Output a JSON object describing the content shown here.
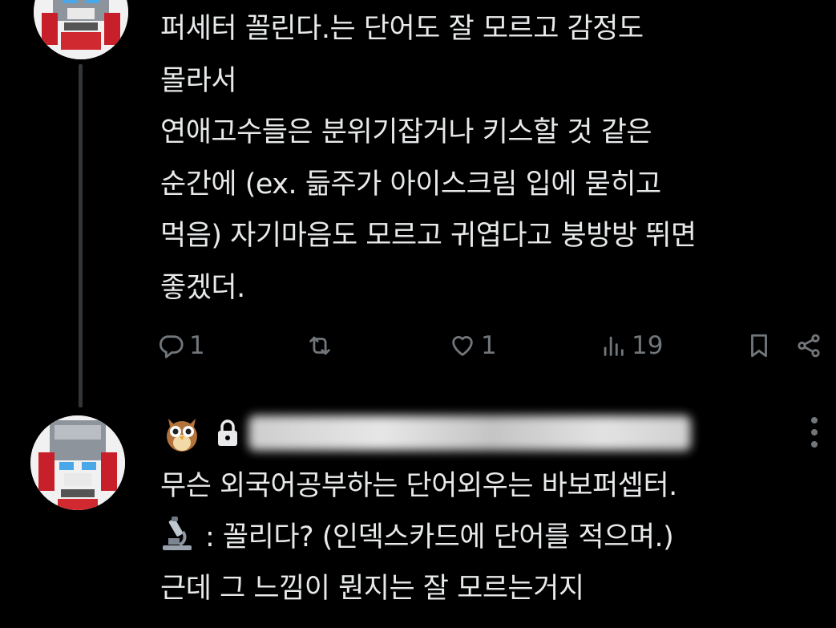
{
  "thread": {
    "tweet1": {
      "avatar": "robot-avatar",
      "lines": [
        "퍼세터 꼴린다.는 단어도 잘 모르고 감정도",
        "몰라서",
        "연애고수들은 분위기잡거나 키스할 것 같은",
        "순간에 (ex. 듦주가 아이스크림 입에 묻히고",
        "먹음) 자기마음도 모르고 귀엽다고 붕방방 뛰면",
        "좋겠더."
      ],
      "actions": {
        "reply_icon": "reply-icon",
        "reply_count": "1",
        "retweet_icon": "retweet-icon",
        "retweet_count": "",
        "like_icon": "heart-icon",
        "like_count": "1",
        "views_icon": "views-icon",
        "views_count": "19",
        "bookmark_icon": "bookmark-icon",
        "share_icon": "share-icon"
      }
    },
    "tweet2": {
      "avatar": "robot-avatar",
      "header": {
        "emoji": "owl-icon",
        "protected_icon": "lock-icon",
        "name_state": "blurred"
      },
      "line1": "무슨 외국어공부하는 단어외우는 바보퍼셉터.",
      "line2_emoji": "microscope-icon",
      "line2_text": ": 꼴리다? (인덱스카드에 단어를 적으며.)",
      "line3": "근데 그 느낌이 뭔지는 잘 모르는거지",
      "more_icon": "more-vertical-icon"
    }
  },
  "colors": {
    "background": "#000000",
    "text": "#e7e9ea",
    "muted": "#71767b",
    "thread_line": "#333639"
  }
}
